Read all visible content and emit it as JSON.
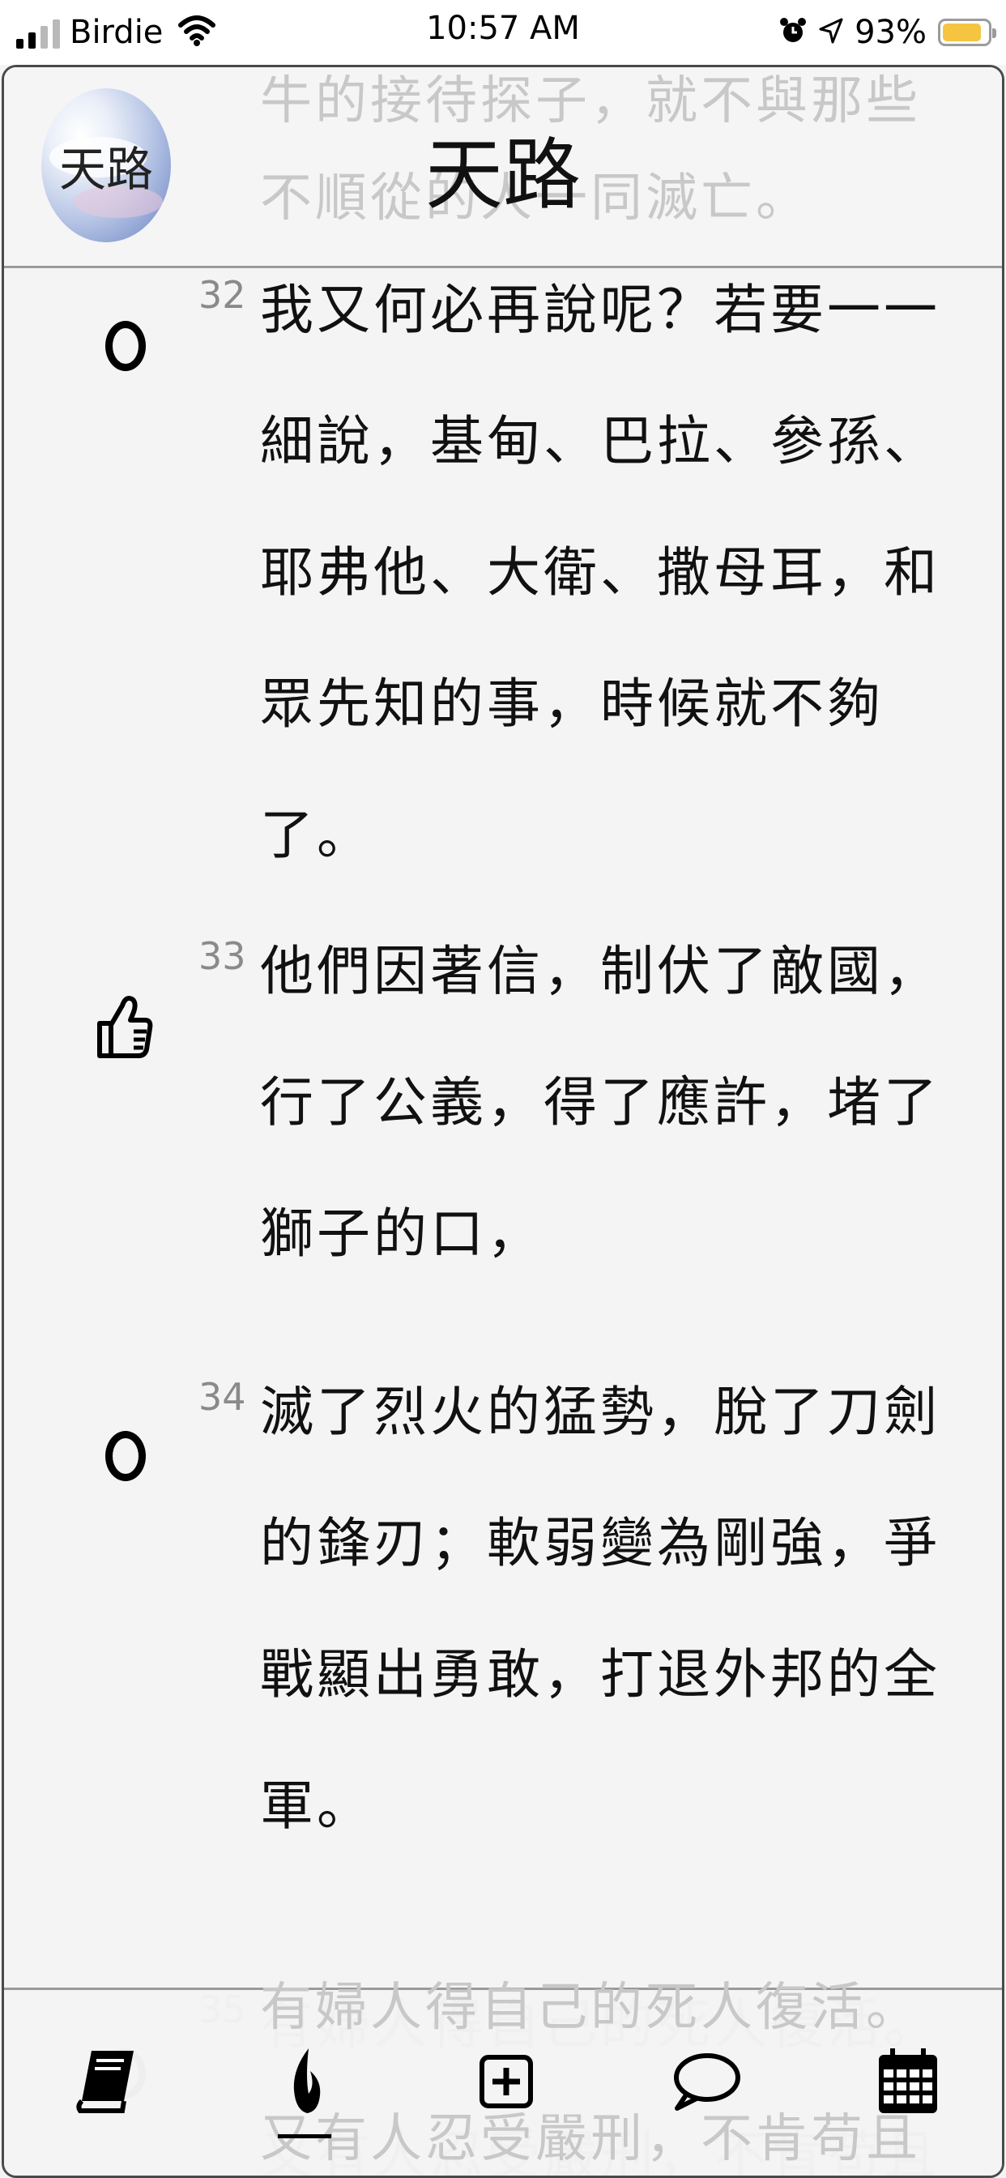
{
  "status_bar": {
    "carrier": "Birdie",
    "time": "10:57 AM",
    "battery_percent": "93%",
    "battery_fill": 0.93,
    "battery_color": "#f5c542"
  },
  "header": {
    "avatar_label": "天路",
    "title": "天路",
    "ghost_line_1": "牛的接待探子，就不與那些",
    "ghost_line_2": "不順從的人一同滅亡。"
  },
  "verses": [
    {
      "number": "32",
      "marker": "circle-icon",
      "lines": [
        "我又何必再說呢？若要一一",
        "細說，基甸、巴拉、參孫、",
        "耶弗他、大衛、撒母耳，和",
        "眾先知的事，時候就不夠",
        "了。"
      ]
    },
    {
      "number": "33",
      "marker": "thumbs-up-icon",
      "lines": [
        "他們因著信，制伏了敵國，",
        "行了公義，得了應許，堵了",
        "獅子的口，"
      ]
    },
    {
      "number": "34",
      "marker": "circle-icon",
      "lines": [
        "滅了烈火的猛勢，脫了刀劍",
        "的鋒刃；軟弱變為剛強，爭",
        "戰顯出勇敢，打退外邦的全",
        "軍。"
      ]
    },
    {
      "number": "35",
      "marker": "circle-icon",
      "lines": [
        "有婦人得自己的死人復活。",
        "又有人忍受嚴刑，不肯苟且"
      ]
    }
  ],
  "tabbar": {
    "tabs": [
      {
        "icon": "book-icon",
        "active": false
      },
      {
        "icon": "flame-icon",
        "active": true
      },
      {
        "icon": "plus-box-icon",
        "active": false
      },
      {
        "icon": "chat-bubble-icon",
        "active": false
      },
      {
        "icon": "calendar-icon",
        "active": false
      }
    ]
  }
}
